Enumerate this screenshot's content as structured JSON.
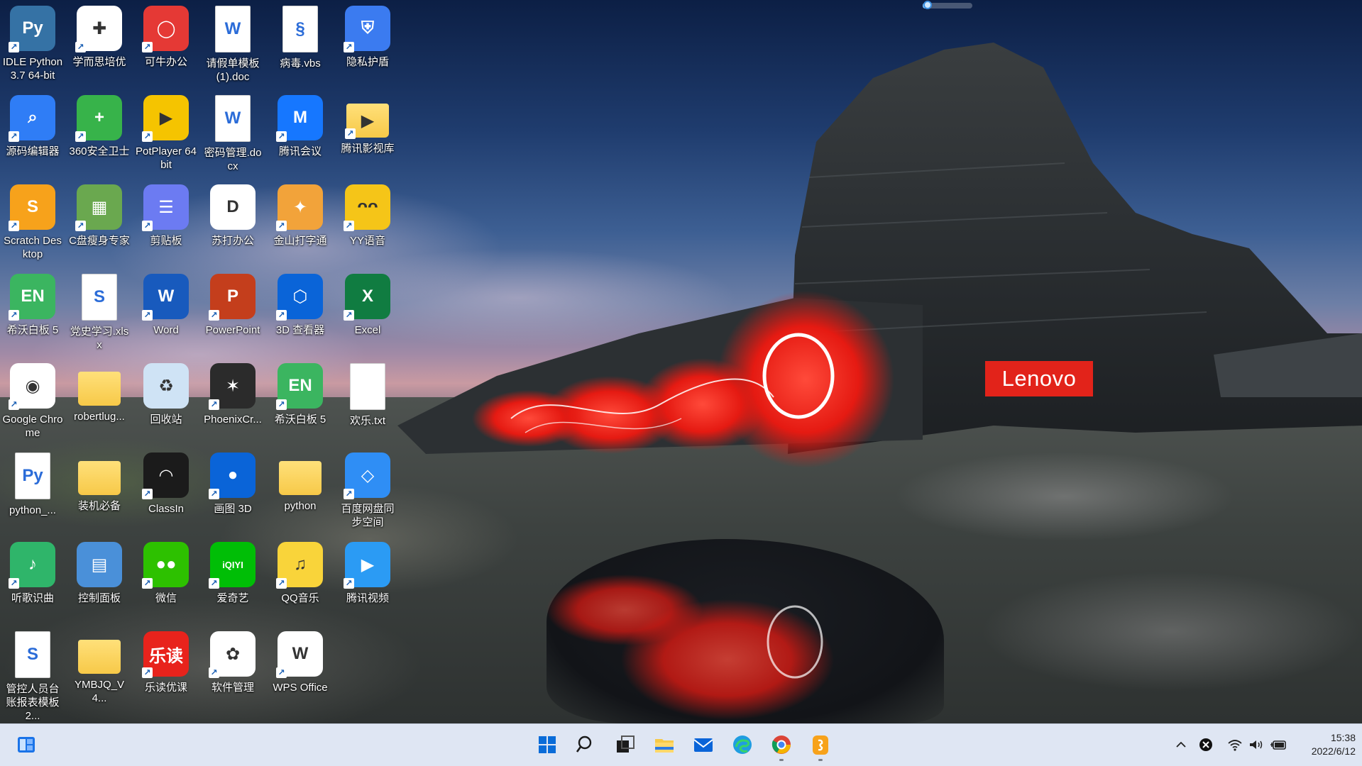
{
  "wallpaper": {
    "brand": "Lenovo",
    "brand_color": "#e2231a"
  },
  "volume": {
    "level": 0.1
  },
  "desktop_icons": [
    {
      "label": "IDLE Python 3.7 64-bit",
      "icon": "python-idle-icon",
      "color": "#3572a5",
      "glyph": "Py",
      "shortcut": true,
      "type": "app"
    },
    {
      "label": "学而思培优",
      "icon": "xueersi-icon",
      "color": "#ffffff",
      "glyph": "✚",
      "shortcut": true,
      "type": "app"
    },
    {
      "label": "可牛办公",
      "icon": "keniu-office-icon",
      "color": "#e53935",
      "glyph": "◯",
      "shortcut": true,
      "type": "app"
    },
    {
      "label": "请假单模板(1).doc",
      "icon": "word-doc-icon",
      "color": "#ffffff",
      "glyph": "W",
      "shortcut": false,
      "type": "doc"
    },
    {
      "label": "病毒.vbs",
      "icon": "vbs-script-icon",
      "color": "#ffffff",
      "glyph": "§",
      "shortcut": false,
      "type": "doc"
    },
    {
      "label": "隐私护盾",
      "icon": "privacy-shield-icon",
      "color": "#3b7bf0",
      "glyph": "⛨",
      "shortcut": true,
      "type": "app"
    },
    {
      "label": "源码编辑器",
      "icon": "code-editor-icon",
      "color": "#2f7df6",
      "glyph": "⌕",
      "shortcut": true,
      "type": "app"
    },
    {
      "label": "360安全卫士",
      "icon": "360-security-icon",
      "color": "#37b34a",
      "glyph": "+",
      "shortcut": true,
      "type": "app"
    },
    {
      "label": "PotPlayer 64 bit",
      "icon": "potplayer-icon",
      "color": "#f5c400",
      "glyph": "▶",
      "shortcut": true,
      "type": "app"
    },
    {
      "label": "密码管理.docx",
      "icon": "word-docx-icon",
      "color": "#ffffff",
      "glyph": "W",
      "shortcut": false,
      "type": "doc"
    },
    {
      "label": "腾讯会议",
      "icon": "tencent-meeting-icon",
      "color": "#1677ff",
      "glyph": "M",
      "shortcut": true,
      "type": "app"
    },
    {
      "label": "腾讯影视库",
      "icon": "tencent-video-library-icon",
      "color": "#f7c948",
      "glyph": "▶",
      "shortcut": true,
      "type": "folder"
    },
    {
      "label": "Scratch Desktop",
      "icon": "scratch-icon",
      "color": "#f7a21b",
      "glyph": "S",
      "shortcut": true,
      "type": "app"
    },
    {
      "label": "C盘瘦身专家",
      "icon": "disk-cleaner-icon",
      "color": "#6aa84f",
      "glyph": "▦",
      "shortcut": true,
      "type": "app"
    },
    {
      "label": "剪贴板",
      "icon": "clipboard-icon",
      "color": "#6c7bf2",
      "glyph": "☰",
      "shortcut": true,
      "type": "app"
    },
    {
      "label": "苏打办公",
      "icon": "suda-office-icon",
      "color": "#ffffff",
      "glyph": "D",
      "shortcut": false,
      "type": "app"
    },
    {
      "label": "金山打字通",
      "icon": "kingsoft-typing-icon",
      "color": "#f2a33a",
      "glyph": "✦",
      "shortcut": true,
      "type": "app"
    },
    {
      "label": "YY语音",
      "icon": "yy-voice-icon",
      "color": "#f5c518",
      "glyph": "ᴖᴖ",
      "shortcut": true,
      "type": "app"
    },
    {
      "label": "希沃白板 5",
      "icon": "seewo-board-icon",
      "color": "#3bb560",
      "glyph": "EN",
      "shortcut": true,
      "type": "app"
    },
    {
      "label": "党史学习.xlsx",
      "icon": "spreadsheet-icon",
      "color": "#ffffff",
      "glyph": "S",
      "shortcut": false,
      "type": "doc"
    },
    {
      "label": "Word",
      "icon": "word-icon",
      "color": "#185abd",
      "glyph": "W",
      "shortcut": true,
      "type": "app"
    },
    {
      "label": "PowerPoint",
      "icon": "powerpoint-icon",
      "color": "#c43e1c",
      "glyph": "P",
      "shortcut": true,
      "type": "app"
    },
    {
      "label": "3D 查看器",
      "icon": "3d-viewer-icon",
      "color": "#0a64d8",
      "glyph": "⬡",
      "shortcut": true,
      "type": "app"
    },
    {
      "label": "Excel",
      "icon": "excel-icon",
      "color": "#107c41",
      "glyph": "X",
      "shortcut": true,
      "type": "app"
    },
    {
      "label": "Google Chrome",
      "icon": "chrome-icon",
      "color": "#ffffff",
      "glyph": "◉",
      "shortcut": true,
      "type": "app"
    },
    {
      "label": "robertlug...",
      "icon": "folder-icon",
      "color": "#f7c948",
      "glyph": "",
      "shortcut": false,
      "type": "folder"
    },
    {
      "label": "回收站",
      "icon": "recycle-bin-icon",
      "color": "#cfe3f5",
      "glyph": "♻",
      "shortcut": false,
      "type": "app"
    },
    {
      "label": "PhoenixCr...",
      "icon": "phoenix-icon",
      "color": "#2b2b2b",
      "glyph": "✶",
      "shortcut": true,
      "type": "app"
    },
    {
      "label": "希沃白板 5",
      "icon": "seewo-board-icon",
      "color": "#3bb560",
      "glyph": "EN",
      "shortcut": true,
      "type": "app"
    },
    {
      "label": "欢乐.txt",
      "icon": "text-file-icon",
      "color": "#ffffff",
      "glyph": "",
      "shortcut": false,
      "type": "doc"
    },
    {
      "label": "python_...",
      "icon": "python-file-icon",
      "color": "#ffffff",
      "glyph": "Py",
      "shortcut": false,
      "type": "doc"
    },
    {
      "label": "装机必备",
      "icon": "folder-icon",
      "color": "#f7c948",
      "glyph": "",
      "shortcut": false,
      "type": "folder"
    },
    {
      "label": "ClassIn",
      "icon": "classin-icon",
      "color": "#1b1b1b",
      "glyph": "◠",
      "shortcut": true,
      "type": "app"
    },
    {
      "label": "画图 3D",
      "icon": "paint-3d-icon",
      "color": "#0a64d8",
      "glyph": "●",
      "shortcut": true,
      "type": "app"
    },
    {
      "label": "python",
      "icon": "folder-icon",
      "color": "#f7c948",
      "glyph": "",
      "shortcut": false,
      "type": "folder"
    },
    {
      "label": "百度网盘同步空间",
      "icon": "baidu-netdisk-icon",
      "color": "#2f8ef5",
      "glyph": "◇",
      "shortcut": true,
      "type": "app"
    },
    {
      "label": "听歌识曲",
      "icon": "music-recognition-icon",
      "color": "#2fb56a",
      "glyph": "♪",
      "shortcut": true,
      "type": "app"
    },
    {
      "label": "控制面板",
      "icon": "control-panel-icon",
      "color": "#4a90d9",
      "glyph": "▤",
      "shortcut": false,
      "type": "app"
    },
    {
      "label": "微信",
      "icon": "wechat-icon",
      "color": "#2dc100",
      "glyph": "●●",
      "shortcut": true,
      "type": "app"
    },
    {
      "label": "爱奇艺",
      "icon": "iqiyi-icon",
      "color": "#00be06",
      "glyph": "iQIYI",
      "shortcut": true,
      "type": "app"
    },
    {
      "label": "QQ音乐",
      "icon": "qq-music-icon",
      "color": "#f9d43a",
      "glyph": "♫",
      "shortcut": true,
      "type": "app"
    },
    {
      "label": "腾讯视频",
      "icon": "tencent-video-icon",
      "color": "#2b9bf4",
      "glyph": "▶",
      "shortcut": true,
      "type": "app"
    },
    {
      "label": "管控人员台账报表模板 2...",
      "icon": "spreadsheet-icon",
      "color": "#ffffff",
      "glyph": "S",
      "shortcut": false,
      "type": "doc"
    },
    {
      "label": "YMBJQ_V4...",
      "icon": "zip-folder-icon",
      "color": "#f7c948",
      "glyph": "",
      "shortcut": false,
      "type": "folder"
    },
    {
      "label": "乐读优课",
      "icon": "ledu-icon",
      "color": "#e8231c",
      "glyph": "乐读",
      "shortcut": true,
      "type": "app"
    },
    {
      "label": "软件管理",
      "icon": "software-manager-icon",
      "color": "#ffffff",
      "glyph": "✿",
      "shortcut": true,
      "type": "app"
    },
    {
      "label": "WPS Office",
      "icon": "wps-office-icon",
      "color": "#ffffff",
      "glyph": "W",
      "shortcut": true,
      "type": "app"
    }
  ],
  "taskbar": {
    "left": {
      "icon": "widgets-icon"
    },
    "pinned": [
      {
        "name": "start-button",
        "icon": "windows-start-icon",
        "running": false
      },
      {
        "name": "search-button",
        "icon": "search-icon",
        "running": false
      },
      {
        "name": "task-view-button",
        "icon": "task-view-icon",
        "running": false
      },
      {
        "name": "file-explorer-button",
        "icon": "file-explorer-icon",
        "running": false
      },
      {
        "name": "mail-button",
        "icon": "mail-icon",
        "running": false
      },
      {
        "name": "edge-button",
        "icon": "edge-icon",
        "running": false
      },
      {
        "name": "chrome-button",
        "icon": "chrome-icon",
        "running": true
      },
      {
        "name": "scratch-button",
        "icon": "scratch-icon",
        "running": true
      }
    ],
    "tray": {
      "overflow_icon": "chevron-up-icon",
      "icons": [
        "antivirus-icon",
        "wifi-icon",
        "volume-icon",
        "battery-icon"
      ],
      "time": "15:38",
      "date": "2022/6/12"
    }
  }
}
